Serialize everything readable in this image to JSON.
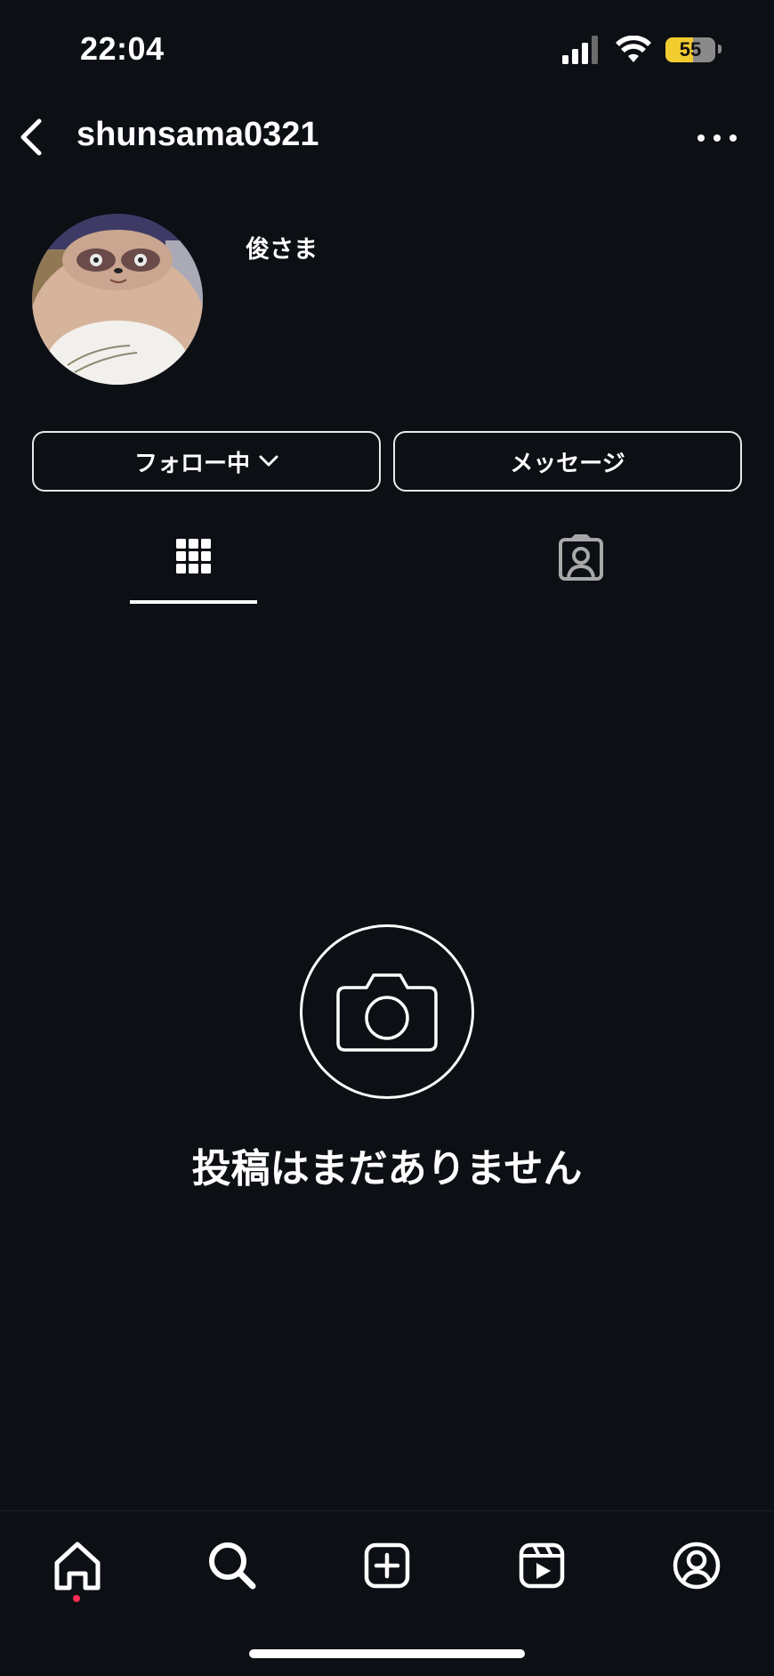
{
  "status_bar": {
    "time": "22:04",
    "battery_level": "55",
    "battery_percent": 55,
    "icons": [
      "cellular-signal-icon",
      "wifi-icon",
      "battery-icon"
    ]
  },
  "header": {
    "username": "shunsama0321",
    "icons": [
      "chevron-left-icon",
      "more-horizontal-icon"
    ]
  },
  "profile": {
    "display_name": "俊さま"
  },
  "actions": {
    "follow_label": "フォロー中",
    "message_label": "メッセージ"
  },
  "tabs": [
    {
      "icon": "grid-icon",
      "active": true
    },
    {
      "icon": "tagged-person-icon",
      "active": false
    }
  ],
  "empty_state": {
    "icon": "camera-icon",
    "text": "投稿はまだありません"
  },
  "bottom_nav": {
    "items": [
      "home-icon",
      "search-icon",
      "create-icon",
      "reels-icon",
      "profile-icon"
    ],
    "notification_dot_color": "#ff2d55"
  },
  "colors": {
    "background": "#0c0f14",
    "text": "#ffffff",
    "battery": "#f2cb2f"
  }
}
